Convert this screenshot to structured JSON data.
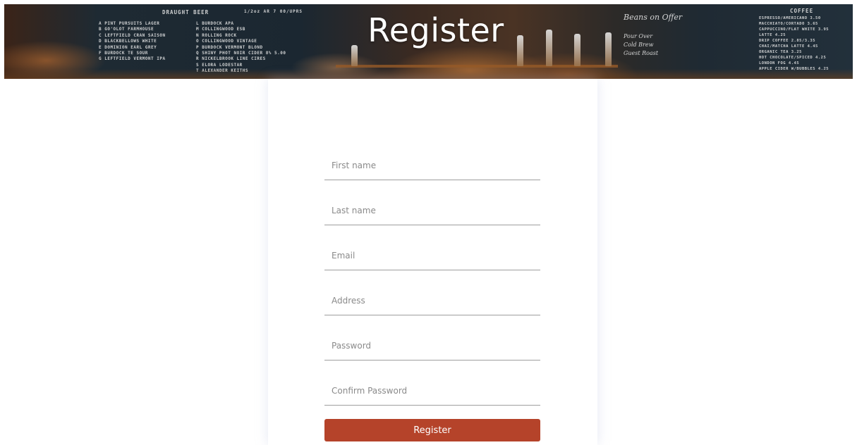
{
  "banner": {
    "title": "Register",
    "draught_board": {
      "header": "DRAUGHT BEER",
      "header_sub": "1/2oz AR 7 00/UPRS",
      "left_column": [
        "A PINT PURSUITS LAGER",
        "B GO'OLOT FARMHOUSE",
        "C LEFTFIELD CRAN SAISON",
        "D BLACKBELLOWS WHITE",
        "E DOMINION EARL GREY",
        "F BURDOCK TE SOUR",
        "G LEFTFIELD VERMONT IPA"
      ],
      "right_column": [
        "L BURDOCK APA",
        "M COLLINGWOOD ESB",
        "N ROLLING ROCK",
        "O COLLINGWOOD VINTAGE",
        "P BURDOCK VERMONT BLOND",
        "Q SHINY PHOT NOIR CIDER 8% 5.00",
        "R NICKELBROOK LINE CIRES",
        "S ELORA LODESTAR",
        "T ALEXANDER KEITHS"
      ]
    },
    "coffee_board": {
      "header": "COFFEE",
      "items": [
        "ESPRESSO/AMERICANO 3.50",
        "MACCHIATO/CORTADO 3.65",
        "CAPPUCCINO/FLAT WHITE 3.95",
        "LATTE 4.25",
        "DRIP COFFEE 2.85/3.35",
        "CHAI/MATCHA LATTE 4.45",
        "ORGANIC TEA 3.25",
        "HOT CHOCOLATE/SPICED 4.25",
        "LONDON FOG 4.45",
        "APPLE CIDER W/BUBBLES 4.25"
      ]
    },
    "chalk_board": {
      "heading": "Beans on Offer",
      "lines": [
        "Pour Over",
        "Cold Brew",
        "Guest Roast"
      ]
    }
  },
  "form": {
    "fields": [
      {
        "name": "first-name-input",
        "type": "text",
        "placeholder": "First name",
        "value": ""
      },
      {
        "name": "last-name-input",
        "type": "text",
        "placeholder": "Last name",
        "value": ""
      },
      {
        "name": "email-input",
        "type": "email",
        "placeholder": "Email",
        "value": ""
      },
      {
        "name": "address-input",
        "type": "text",
        "placeholder": "Address",
        "value": ""
      },
      {
        "name": "password-input",
        "type": "password",
        "placeholder": "Password",
        "value": ""
      },
      {
        "name": "confirm-password-input",
        "type": "password",
        "placeholder": "Confirm Password",
        "value": ""
      }
    ],
    "submit_label": "Register"
  },
  "colors": {
    "accent": "#b5432a",
    "field_underline": "#9e9e9e",
    "placeholder": "#8a8a8a",
    "banner_title": "#ffffff"
  }
}
